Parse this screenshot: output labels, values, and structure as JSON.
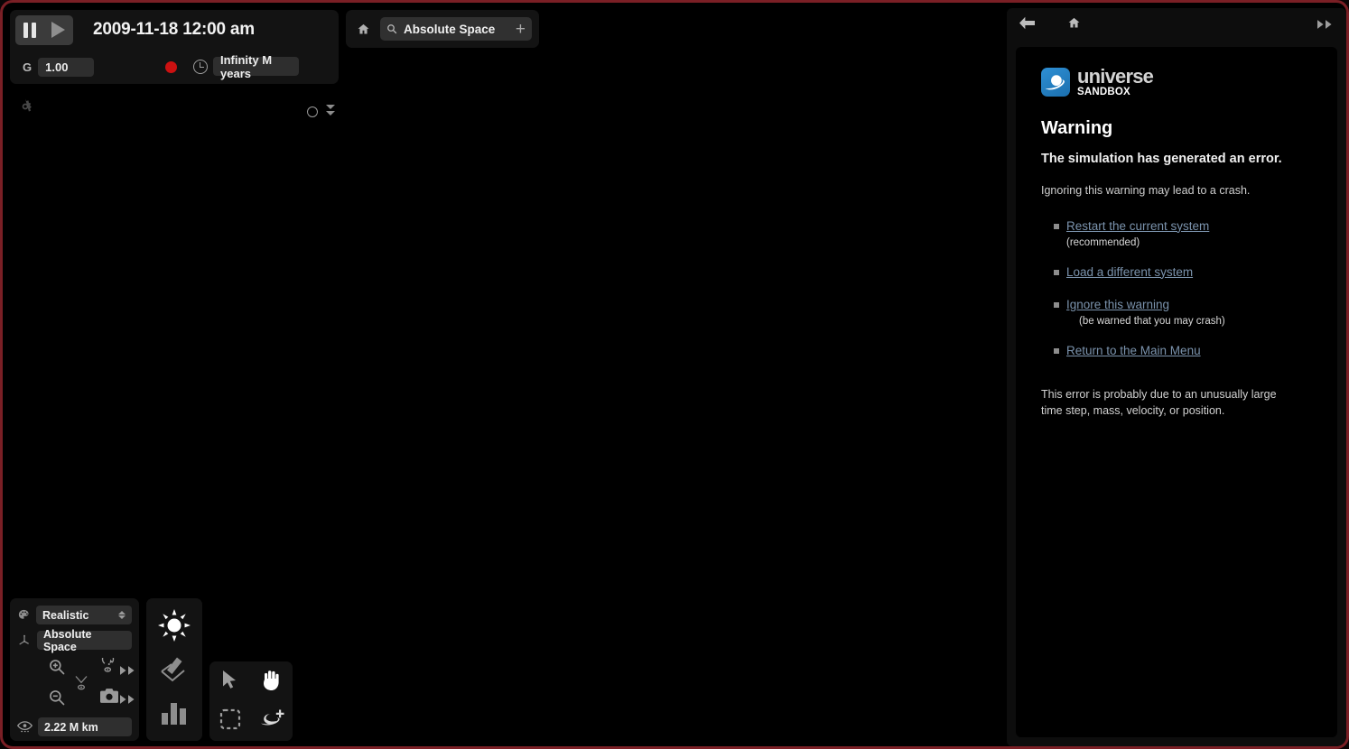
{
  "window": {
    "border_color": "#7a1f25",
    "background": "#000000"
  },
  "sim_panel": {
    "pause_icon": "pause-icon",
    "play_icon": "play-icon",
    "date": "2009-11-18 12:00 am",
    "gravity_label": "G",
    "gravity_value": "1.00",
    "record_indicator": "record-dot",
    "record_color": "#cc1111",
    "clock_icon": "clock-icon",
    "timespan_value": "Infinity M years",
    "circle_icon": "circle-outline-icon",
    "expand_icon": "double-chevron-down-icon",
    "settings_icon": "gear-icon"
  },
  "tabbar": {
    "home_icon": "home-icon",
    "search_icon": "search-icon",
    "tab_name": "Absolute Space",
    "add_label": "+"
  },
  "view_panel": {
    "render_mode_icon": "palette-icon",
    "render_mode": "Realistic",
    "spinner_icon": "spinner-updown-icon",
    "reference_frame_icon": "axis-icon",
    "reference_frame": "Absolute Space",
    "zoom_in_icon": "zoom-in-icon",
    "zoom_out_icon": "zoom-out-icon",
    "trails_icon": "trails-icon",
    "rotate_icon": "rotate-orbit-icon",
    "rotate_fast_icon": "fast-forward-icon",
    "camera_icon": "camera-icon",
    "camera_fast_icon": "fast-forward-icon",
    "view_distance_icon": "eye-icon",
    "view_distance": "2.22 M km"
  },
  "mid_toolbar": {
    "items": [
      {
        "icon": "sun-icon",
        "active": true
      },
      {
        "icon": "draw-pen-icon",
        "active": false
      },
      {
        "icon": "bar-chart-icon",
        "active": false
      }
    ]
  },
  "select_tools": {
    "items": [
      {
        "icon": "cursor-arrow-icon",
        "active": false
      },
      {
        "icon": "pan-hand-icon",
        "active": true
      },
      {
        "icon": "marquee-select-icon",
        "active": false
      },
      {
        "icon": "add-planet-icon",
        "active": false
      }
    ]
  },
  "right_panel": {
    "nav": {
      "back_icon": "back-arrow-icon",
      "home_icon": "home-icon",
      "collapse_icon": "double-chevron-right-icon"
    },
    "logo": {
      "icon": "ringed-planet-icon",
      "word_top": "universe",
      "word_bottom": "SANDBOX",
      "brand_color": "#2e8fd4"
    },
    "title": "Warning",
    "subtitle": "The simulation has generated an error.",
    "note": "Ignoring this warning may lead to a crash.",
    "options": [
      {
        "label": "Restart the current system",
        "hint": "(recommended)",
        "hint_indent": false
      },
      {
        "label": "Load a different system",
        "hint": "",
        "hint_indent": false
      },
      {
        "label": "Ignore this warning",
        "hint": "(be warned that you may crash)",
        "hint_indent": true
      },
      {
        "label": "Return to the Main Menu",
        "hint": "",
        "hint_indent": false
      }
    ],
    "footer": "This error is probably due to an unusually large time step, mass, velocity, or position.",
    "link_color": "#7b93ad"
  }
}
